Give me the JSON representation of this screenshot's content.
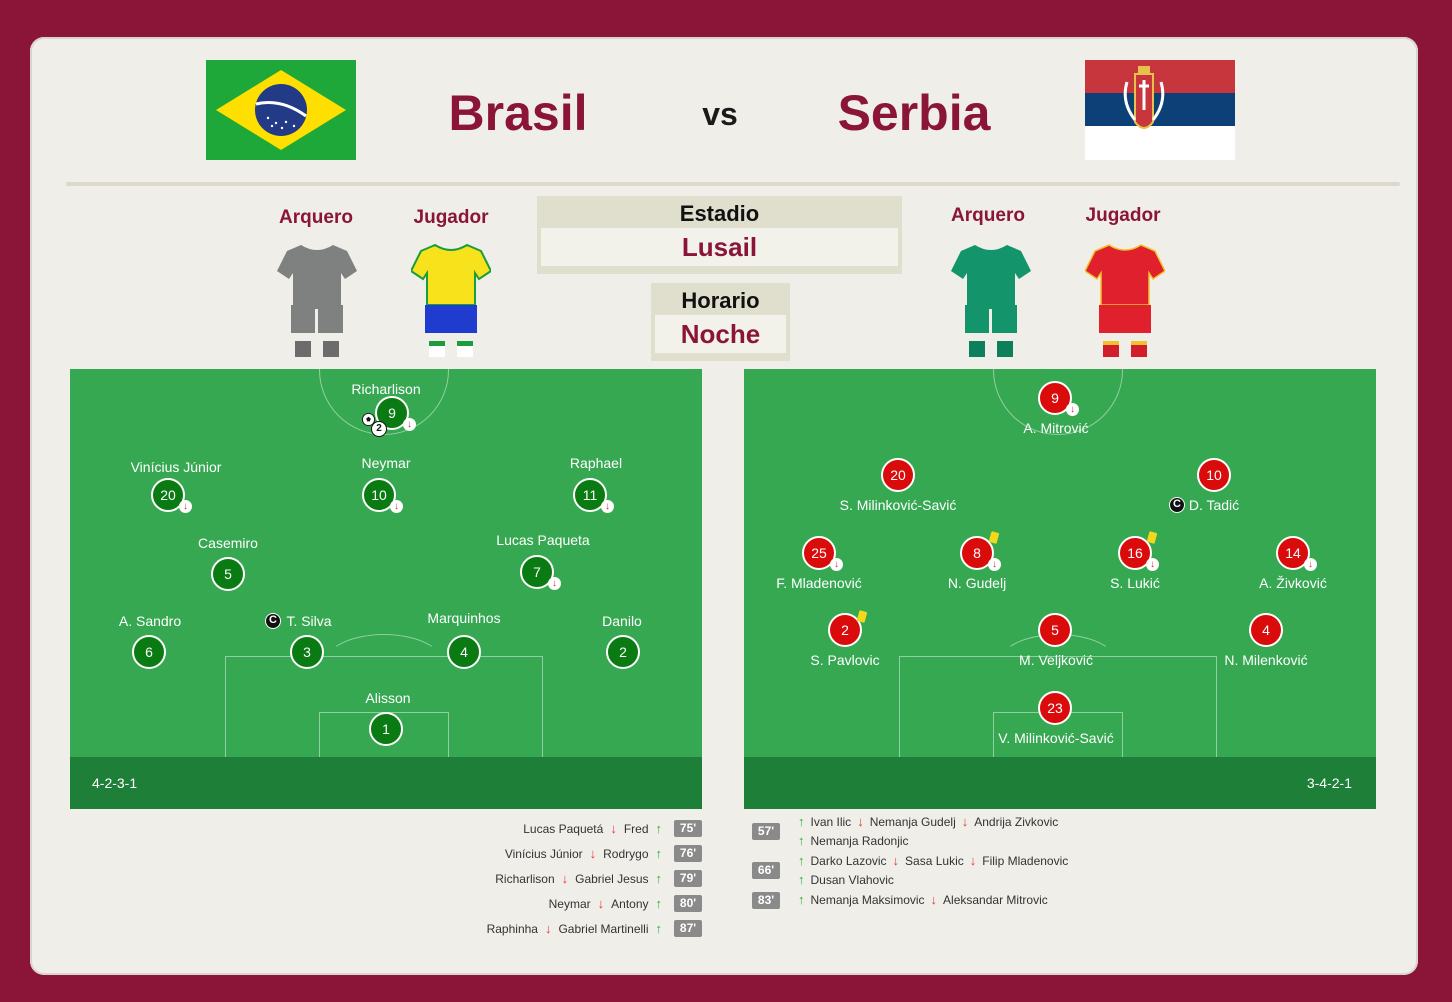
{
  "header": {
    "home_team": "Brasil",
    "away_team": "Serbia",
    "vs_label": "vs"
  },
  "colors": {
    "brand": "#8a1538",
    "pitch": "#36a852",
    "pitch_band": "#1e7f38",
    "home_dot": "#0a7a12",
    "away_dot": "#d90b0b"
  },
  "venue": {
    "stadium_label": "Estadio",
    "stadium_value": "Lusail",
    "time_label": "Horario",
    "time_value": "Noche"
  },
  "kits": {
    "home": {
      "goalkeeper_label": "Arquero",
      "player_label": "Jugador"
    },
    "away": {
      "goalkeeper_label": "Arquero",
      "player_label": "Jugador"
    }
  },
  "home_lineup": {
    "formation": "4-2-3-1",
    "players": [
      {
        "name": "Richarlison",
        "number": "9",
        "goals": "2"
      },
      {
        "name": "Vinícius Júnior",
        "number": "20"
      },
      {
        "name": "Neymar",
        "number": "10"
      },
      {
        "name": "Raphael",
        "number": "11"
      },
      {
        "name": "Casemiro",
        "number": "5"
      },
      {
        "name": "Lucas Paqueta",
        "number": "7"
      },
      {
        "name": "A. Sandro",
        "number": "6"
      },
      {
        "name": "T. Silva",
        "number": "3",
        "captain": "C"
      },
      {
        "name": "Marquinhos",
        "number": "4"
      },
      {
        "name": "Danilo",
        "number": "2"
      },
      {
        "name": "Alisson",
        "number": "1"
      }
    ]
  },
  "away_lineup": {
    "formation": "3-4-2-1",
    "players": [
      {
        "name": "A. Mitrović",
        "number": "9"
      },
      {
        "name": "S. Milinković-Savić",
        "number": "20"
      },
      {
        "name": "D. Tadić",
        "number": "10",
        "captain": "C"
      },
      {
        "name": "F. Mladenović",
        "number": "25"
      },
      {
        "name": "N. Gudelj",
        "number": "8"
      },
      {
        "name": "S. Lukić",
        "number": "16"
      },
      {
        "name": "A. Živković",
        "number": "14"
      },
      {
        "name": "S. Pavlovic",
        "number": "2"
      },
      {
        "name": "M. Veljković",
        "number": "5"
      },
      {
        "name": "N. Milenković",
        "number": "4"
      },
      {
        "name": "V. Milinković-Savić",
        "number": "23"
      }
    ]
  },
  "home_subs": [
    {
      "out": "Lucas Paquetá",
      "in": "Fred",
      "minute": "75'"
    },
    {
      "out": "Vinícius Júnior",
      "in": "Rodrygo",
      "minute": "76'"
    },
    {
      "out": "Richarlison",
      "in": "Gabriel Jesus",
      "minute": "79'"
    },
    {
      "out": "Neymar",
      "in": "Antony",
      "minute": "80'"
    },
    {
      "out": "Raphinha",
      "in": "Gabriel Martinelli",
      "minute": "87'"
    }
  ],
  "away_subs": [
    {
      "minute": "57'",
      "in1": "Ivan Ilic",
      "out1": "Nemanja Gudelj",
      "out2": "Andrija Zivkovic",
      "in2": "Nemanja Radonjic"
    },
    {
      "minute": "66'",
      "in1": "Darko Lazovic",
      "out1": "Sasa Lukic",
      "out2": "Filip Mladenovic",
      "in2": "Dusan Vlahovic"
    },
    {
      "minute": "83'",
      "in1": "Nemanja Maksimovic",
      "out1": "Aleksandar Mitrovic"
    }
  ],
  "icons": {
    "sub_off": "arrow-down-icon",
    "sub_on": "arrow-up-icon",
    "captain": "captain-icon",
    "yellow_card": "yellow-card-icon",
    "goal": "ball-icon"
  }
}
